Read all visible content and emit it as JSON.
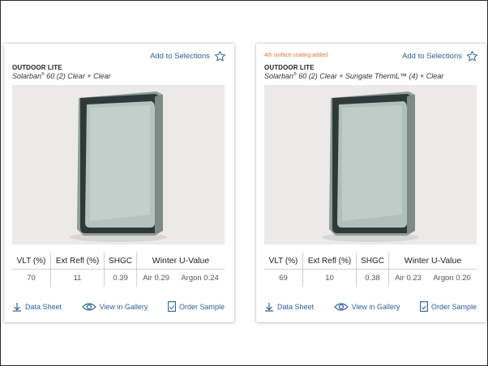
{
  "colors": {
    "link": "#2f6098",
    "note": "#e07a3a",
    "border": "#cfcfcf"
  },
  "cards": [
    {
      "note": "",
      "add_to_selections": "Add to Selections",
      "lite_label": "OUTDOOR LITE",
      "product_brand": "Solarban",
      "product_reg": "®",
      "product_rest": " 60 (2) Clear + Clear",
      "headers": {
        "vlt": "VLT (%)",
        "ext_refl": "Ext Refl (%)",
        "shgc": "SHGC",
        "winter_u": "Winter U-Value"
      },
      "values": {
        "vlt": "70",
        "ext_refl": "11",
        "shgc": "0.39",
        "air": "Air 0.29",
        "argon": "Argon 0.24"
      },
      "actions": {
        "data_sheet": "Data Sheet",
        "view_gallery": "View in Gallery",
        "order_sample": "Order Sample"
      }
    },
    {
      "note": "4th surface coating added",
      "add_to_selections": "Add to Selections",
      "lite_label": "OUTDOOR LITE",
      "product_brand": "Solarban",
      "product_reg": "®",
      "product_rest": " 60 (2) Clear + Sungate ThermL™ (4) + Clear",
      "headers": {
        "vlt": "VLT (%)",
        "ext_refl": "Ext Refl (%)",
        "shgc": "SHGC",
        "winter_u": "Winter U-Value"
      },
      "values": {
        "vlt": "69",
        "ext_refl": "10",
        "shgc": "0.38",
        "air": "Air 0.23",
        "argon": "Argon 0.20"
      },
      "actions": {
        "data_sheet": "Data Sheet",
        "view_gallery": "View in Gallery",
        "order_sample": "Order Sample"
      }
    }
  ]
}
